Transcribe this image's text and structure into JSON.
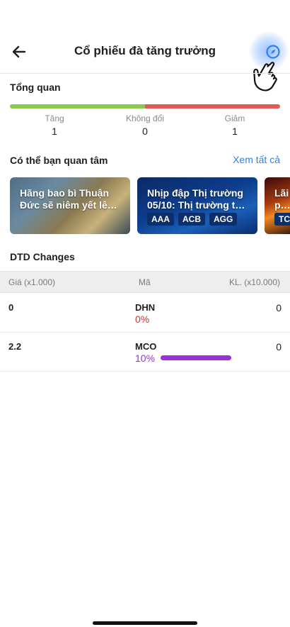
{
  "header": {
    "title": "Cổ phiếu đà tăng trưởng",
    "back_icon": "arrow-left-icon",
    "action_icon": "compass-icon"
  },
  "overview": {
    "title": "Tổng quan",
    "increase_ratio": 0.5,
    "colors": {
      "increase": "#8cc751",
      "decrease": "#e05b55"
    },
    "stats": [
      {
        "label": "Tăng",
        "value": "1"
      },
      {
        "label": "Không đổi",
        "value": "0"
      },
      {
        "label": "Giảm",
        "value": "1"
      }
    ]
  },
  "interest": {
    "title": "Có thể bạn quan tâm",
    "see_all": "Xem tất cả",
    "cards": [
      {
        "text": "Hãng bao bì Thuận Đức sẽ niêm yết lê…",
        "tags": []
      },
      {
        "text": "Nhịp đập Thị trường 05/10: Thị trường t…",
        "tags": [
          "AAA",
          "ACB",
          "AGG"
        ]
      },
      {
        "text": "Lãi cổ p…",
        "tags": [
          "TC"
        ]
      }
    ]
  },
  "changes": {
    "title": "DTD Changes",
    "columns": {
      "price": "Giá (x1.000)",
      "code": "Mã",
      "volume": "KL. (x10.000)"
    },
    "rows": [
      {
        "price": "0",
        "code": "DHN",
        "pct": "0%",
        "pct_color": "#c0392b",
        "volume": "0",
        "bar": 0
      },
      {
        "price": "2.2",
        "code": "MCO",
        "pct": "10%",
        "pct_color": "#9b30d9",
        "volume": "0",
        "bar": 1
      }
    ]
  }
}
